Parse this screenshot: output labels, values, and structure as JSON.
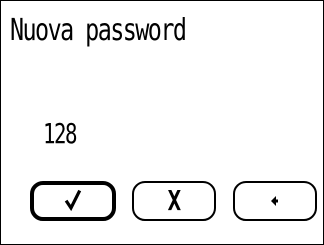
{
  "dialog": {
    "title": "Nuova password",
    "entered_value": "128"
  },
  "buttons": {
    "confirm": {
      "icon": "check-icon",
      "selected": true
    },
    "cancel": {
      "label": "X",
      "icon": "close-icon"
    },
    "back": {
      "icon": "arrow-left-icon"
    }
  },
  "colors": {
    "background": "#ffffff",
    "foreground": "#000000"
  }
}
